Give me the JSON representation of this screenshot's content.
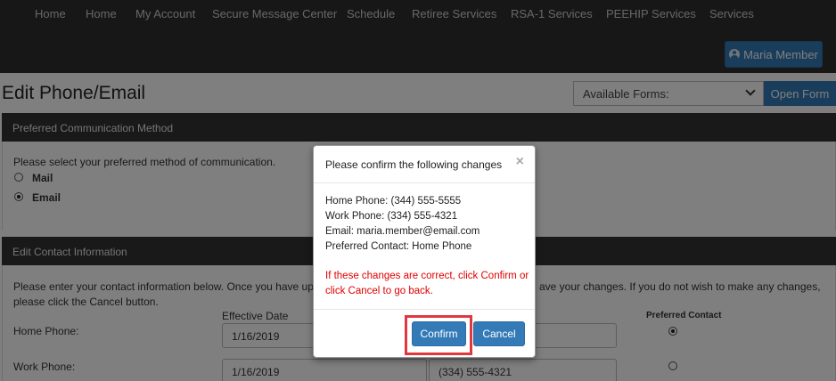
{
  "nav": {
    "items": [
      "Home",
      "Home",
      "My Account",
      "Secure Message Center",
      "Schedule",
      "Retiree Services",
      "RSA-1 Services",
      "PEEHIP Services",
      "Services"
    ],
    "user_label": "Maria Member"
  },
  "page": {
    "title": "Edit Phone/Email",
    "forms_select_value": "Available Forms:",
    "open_form_label": "Open Form"
  },
  "preferred": {
    "header": "Preferred Communication Method",
    "prompt": "Please select your preferred method of communication.",
    "options": [
      {
        "label": "Mail",
        "checked": false
      },
      {
        "label": "Email",
        "checked": true
      }
    ]
  },
  "contact": {
    "header": "Edit Contact Information",
    "instructions_left": "Please enter your contact information below. Once you have upda",
    "instructions_right": "ave your changes. If you do not wish to make any changes,",
    "instructions_line2": "please click the Cancel button.",
    "effective_date_label": "Effective Date",
    "preferred_contact_label": "Preferred Contact",
    "rows": [
      {
        "label": "Home Phone:",
        "date": "1/16/2019",
        "number": "",
        "preferred": true
      },
      {
        "label": "Work Phone:",
        "date": "1/16/2019",
        "number": "(334) 555-4321",
        "preferred": false
      }
    ]
  },
  "modal": {
    "title": "Please confirm the following changes",
    "close_glyph": "×",
    "lines": [
      "Home Phone: (344) 555-5555",
      "Work Phone: (334) 555-4321",
      "Email: maria.member@email.com",
      "Preferred Contact: Home Phone"
    ],
    "warning_lines": [
      "If these changes are correct, click Confirm or",
      "click Cancel to go back."
    ],
    "confirm_label": "Confirm",
    "cancel_label": "Cancel",
    "highlight_color": "#e3373f"
  },
  "colors": {
    "nav_bg": "#2e2e2e",
    "accent": "#337ab7",
    "panel_header_bg": "#333333",
    "warning": "#e00000"
  }
}
